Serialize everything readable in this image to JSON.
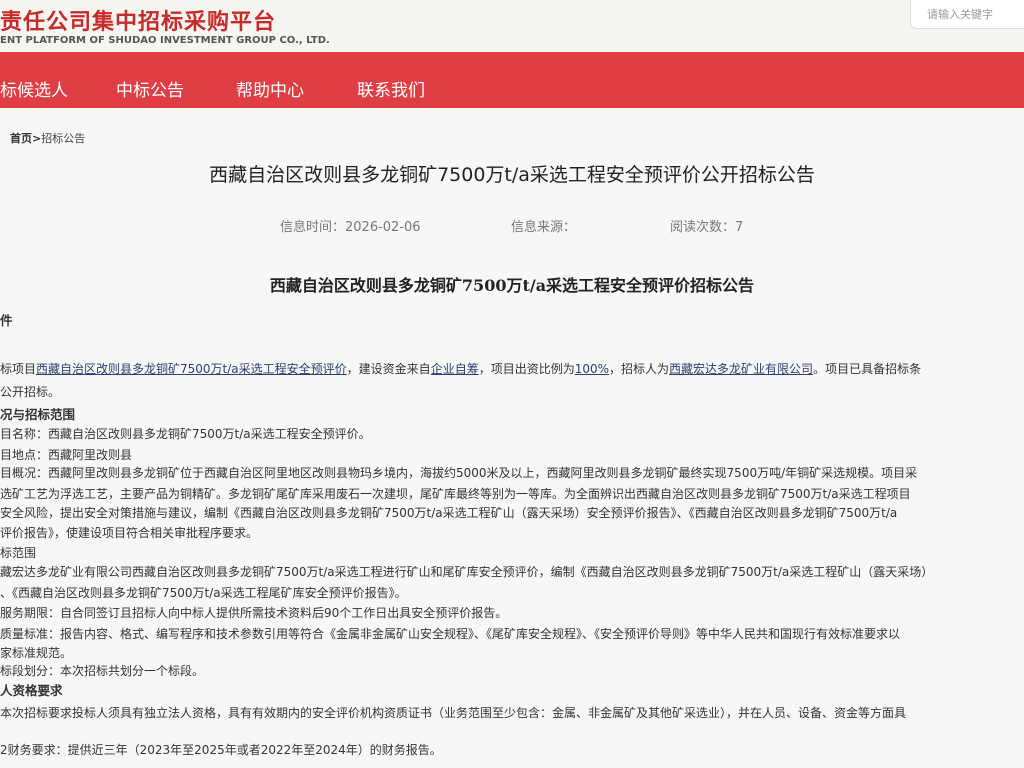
{
  "header": {
    "logo_cn": "责任公司集中招标采购平台",
    "logo_en": "ENT PLATFORM OF SHUDAO INVESTMENT GROUP CO., LTD.",
    "search_placeholder": "请输入关键字"
  },
  "nav": {
    "items": [
      "标候选人",
      "中标公告",
      "帮助中心",
      "联系我们"
    ]
  },
  "breadcrumb": {
    "home": "首页",
    "sep": ">",
    "current": "招标公告"
  },
  "article": {
    "title": "西藏自治区改则县多龙铜矿7500万t/a采选工程安全预评价公开招标公告",
    "meta": {
      "time_label": "信息时间：",
      "time_value": "2026-02-06",
      "source_label": "信息来源：",
      "reads_label": "阅读次数：",
      "reads_value": "7"
    },
    "subtitle": "西藏自治区改则县多龙铜矿7500万t/a采选工程安全预评价招标公告",
    "body": {
      "s1": "件",
      "p1a": "标项目",
      "p1b": "西藏自治区改则县多龙铜矿7500万t/a采选工程安全预评价",
      "p1c": "，建设资金来自",
      "p1d": "企业自筹",
      "p1e": "，项目出资比例为",
      "p1f": "100%",
      "p1g": "，招标人为",
      "p1h": "西藏宏达多龙矿业有限公司",
      "p1i": "。项目已具备招标条",
      "p2": "公开招标。",
      "s2": "况与招标范围",
      "l1": "目名称：西藏自治区改则县多龙铜矿7500万t/a采选工程安全预评价。",
      "l2": "目地点：西藏阿里改则县",
      "l3": "目概况：西藏阿里改则县多龙铜矿位于西藏自治区阿里地区改则县物玛乡境内，海拔约5000米及以上，西藏阿里改则县多龙铜矿最终实现7500万吨/年铜矿采选规模。项目采",
      "l4": "选矿工艺为浮选工艺，主要产品为铜精矿。多龙铜矿尾矿库采用废石一次建坝，尾矿库最终等别为一等库。为全面辨识出西藏自治区改则县多龙铜矿7500万t/a采选工程项目",
      "l5": "安全风险，提出安全对策措施与建议，编制《西藏自治区改则县多龙铜矿7500万t/a采选工程矿山（露天采场）安全预评价报告》、《西藏自治区改则县多龙铜矿7500万t/a",
      "l6": "评价报告》，使建设项目符合相关审批程序要求。",
      "l7": "标范围",
      "l8": "藏宏达多龙矿业有限公司西藏自治区改则县多龙铜矿7500万t/a采选工程进行矿山和尾矿库安全预评价，编制《西藏自治区改则县多龙铜矿7500万t/a采选工程矿山（露天采场）",
      "l9": "、《西藏自治区改则县多龙铜矿7500万t/a采选工程尾矿库安全预评价报告》。",
      "l10": "服务期限：自合同签订且招标人向中标人提供所需技术资料后90个工作日出具安全预评价报告。",
      "l11": "质量标准：报告内容、格式、编写程序和技术参数引用等符合《金属非金属矿山安全规程》、《尾矿库安全规程》、《安全预评价导则》等中华人民共和国现行有效标准要求以",
      "l12": "家标准规范。",
      "l13": "标段划分：本次招标共划分一个标段。",
      "s3": "人资格要求",
      "l14": "本次招标要求投标人须具有独立法人资格，具有有效期内的安全评价机构资质证书（业务范围至少包含：金属、非金属矿及其他矿采选业），并在人员、设备、资金等方面具",
      "l15": "2财务要求：提供近三年（2023年至2025年或者2022年至2024年）的财务报告。"
    }
  }
}
